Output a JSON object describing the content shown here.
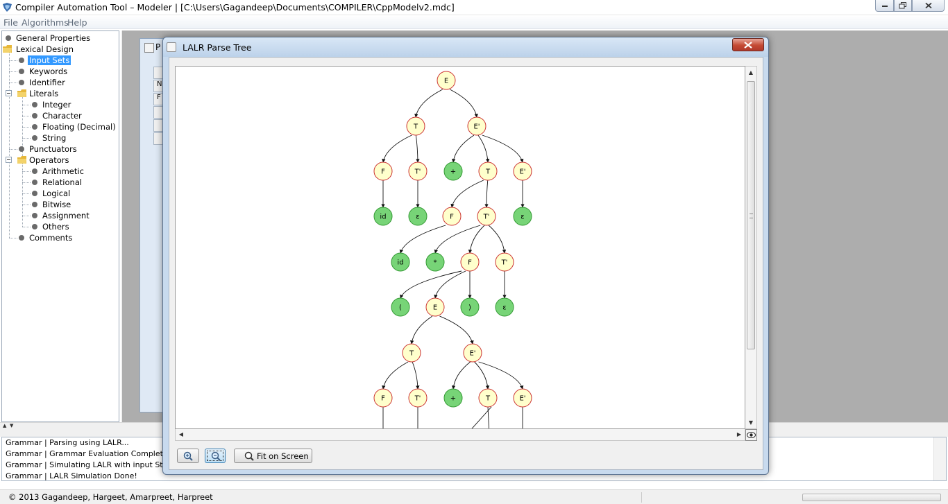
{
  "window": {
    "title": "Compiler Automation Tool – Modeler | [C:\\Users\\Gagandeep\\Documents\\COMPILER\\CppModelv2.mdc]"
  },
  "menu": {
    "items": [
      "File",
      "Algorithms",
      "Help"
    ]
  },
  "tree": {
    "general_properties": "General Properties",
    "lexical_design": "Lexical Design",
    "input_sets": "Input Sets",
    "keywords": "Keywords",
    "identifier": "Identifier",
    "literals": "Literals",
    "integer": "Integer",
    "character": "Character",
    "floating": "Floating (Decimal)",
    "string": "String",
    "punctuators": "Punctuators",
    "operators": "Operators",
    "arithmetic": "Arithmetic",
    "relational": "Relational",
    "logical": "Logical",
    "bitwise": "Bitwise",
    "assignment": "Assignment",
    "others": "Others",
    "comments": "Comments"
  },
  "background_frame": {
    "title_fragment": "P",
    "cell_fragments": [
      "N",
      "F"
    ]
  },
  "dialog": {
    "title": "LALR Parse Tree",
    "fit_button_label": "Fit on Screen",
    "icons": [
      "java-cup-icon",
      "zoom-in-icon",
      "zoom-out-icon",
      "magnifier-icon",
      "eye-icon",
      "close-icon"
    ]
  },
  "log": {
    "lines": [
      "Grammar | Parsing using LALR...",
      "Grammar | Grammar Evaluation Completed!",
      "Grammar | Simulating LALR with input String : id",
      "Grammar | LALR Simulation Done!"
    ]
  },
  "status": {
    "copyright": "© 2013 Gagandeep, Hargeet, Amarpreet, Harpreet"
  },
  "colors": {
    "nonterminal_fill": "#ffffcc",
    "nonterminal_stroke": "#cc3333",
    "terminal_fill": "#77d477",
    "terminal_stroke": "#339933",
    "selection": "#3399ff"
  },
  "parse_tree": {
    "nodes": [
      {
        "id": 1,
        "label": "E",
        "kind": "nonterminal"
      },
      {
        "id": 2,
        "label": "T",
        "kind": "nonterminal",
        "parent": 1
      },
      {
        "id": 3,
        "label": "E'",
        "kind": "nonterminal",
        "parent": 1
      },
      {
        "id": 4,
        "label": "F",
        "kind": "nonterminal",
        "parent": 2
      },
      {
        "id": 5,
        "label": "T'",
        "kind": "nonterminal",
        "parent": 2
      },
      {
        "id": 6,
        "label": "+",
        "kind": "terminal",
        "parent": 3
      },
      {
        "id": 7,
        "label": "T",
        "kind": "nonterminal",
        "parent": 3
      },
      {
        "id": 8,
        "label": "E'",
        "kind": "nonterminal",
        "parent": 3
      },
      {
        "id": 9,
        "label": "id",
        "kind": "terminal",
        "parent": 4
      },
      {
        "id": 10,
        "label": "ε",
        "kind": "terminal",
        "parent": 5
      },
      {
        "id": 11,
        "label": "F",
        "kind": "nonterminal",
        "parent": 7
      },
      {
        "id": 12,
        "label": "T'",
        "kind": "nonterminal",
        "parent": 7
      },
      {
        "id": 13,
        "label": "ε",
        "kind": "terminal",
        "parent": 8
      },
      {
        "id": 14,
        "label": "id",
        "kind": "terminal",
        "parent": 11
      },
      {
        "id": 15,
        "label": "*",
        "kind": "terminal",
        "parent": 12
      },
      {
        "id": 16,
        "label": "F",
        "kind": "nonterminal",
        "parent": 12
      },
      {
        "id": 17,
        "label": "T'",
        "kind": "nonterminal",
        "parent": 12
      },
      {
        "id": 18,
        "label": "(",
        "kind": "terminal",
        "parent": 16
      },
      {
        "id": 19,
        "label": "E",
        "kind": "nonterminal",
        "parent": 16
      },
      {
        "id": 20,
        "label": ")",
        "kind": "terminal",
        "parent": 16
      },
      {
        "id": 21,
        "label": "ε",
        "kind": "terminal",
        "parent": 17
      },
      {
        "id": 22,
        "label": "T",
        "kind": "nonterminal",
        "parent": 19
      },
      {
        "id": 23,
        "label": "E'",
        "kind": "nonterminal",
        "parent": 19
      },
      {
        "id": 24,
        "label": "F",
        "kind": "nonterminal",
        "parent": 22
      },
      {
        "id": 25,
        "label": "T'",
        "kind": "nonterminal",
        "parent": 22
      },
      {
        "id": 26,
        "label": "+",
        "kind": "terminal",
        "parent": 23
      },
      {
        "id": 27,
        "label": "T",
        "kind": "nonterminal",
        "parent": 23
      },
      {
        "id": 28,
        "label": "E'",
        "kind": "nonterminal",
        "parent": 23
      }
    ]
  }
}
